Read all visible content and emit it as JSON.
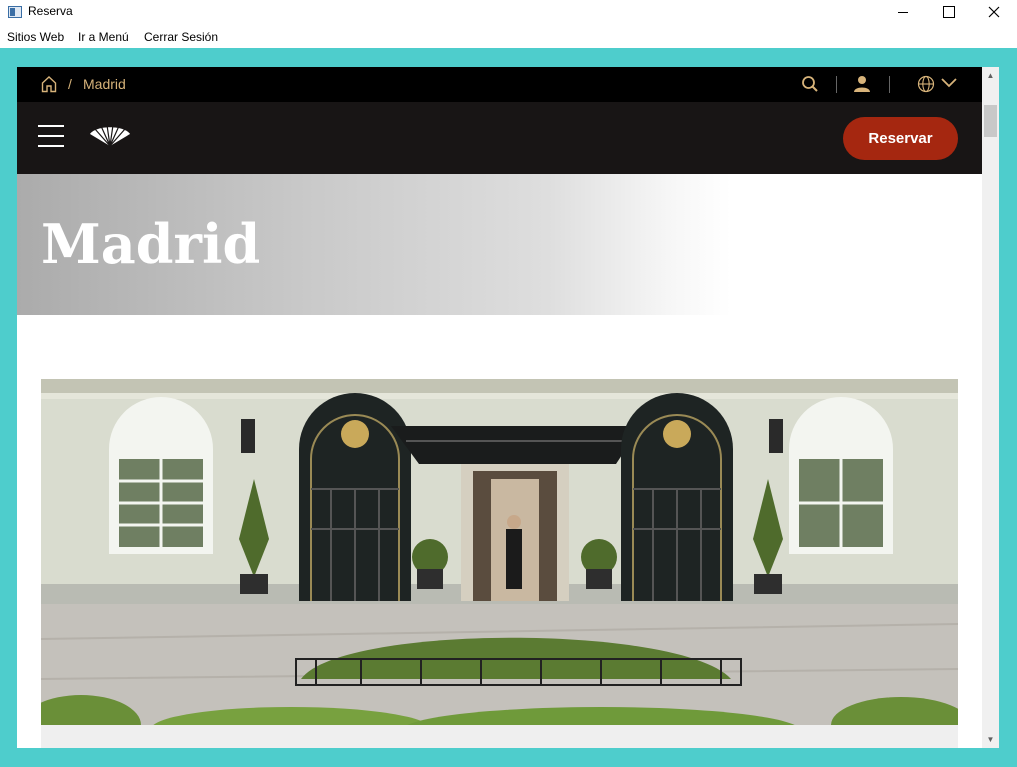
{
  "window": {
    "title": "Reserva"
  },
  "menu": {
    "items": [
      "Sitios Web",
      "Ir a Menú",
      "Cerrar Sesión"
    ]
  },
  "site": {
    "breadcrumb": {
      "separator": "/",
      "current": "Madrid"
    },
    "reserve_label": "Reservar",
    "hero_title": "Madrid"
  },
  "icons": {
    "home": "home-icon",
    "search": "search-icon",
    "user": "user-icon",
    "language": "globe-icon",
    "dropdown": "chevron-down-icon",
    "menu": "hamburger-icon",
    "logo": "fan-logo",
    "scroll_up": "▲",
    "scroll_down": "▼"
  },
  "colors": {
    "frame": "#4ecdcc",
    "topbar": "#000000",
    "navbar": "#181515",
    "accent_gold": "#d7b37a",
    "reserve_button": "#a52710"
  }
}
